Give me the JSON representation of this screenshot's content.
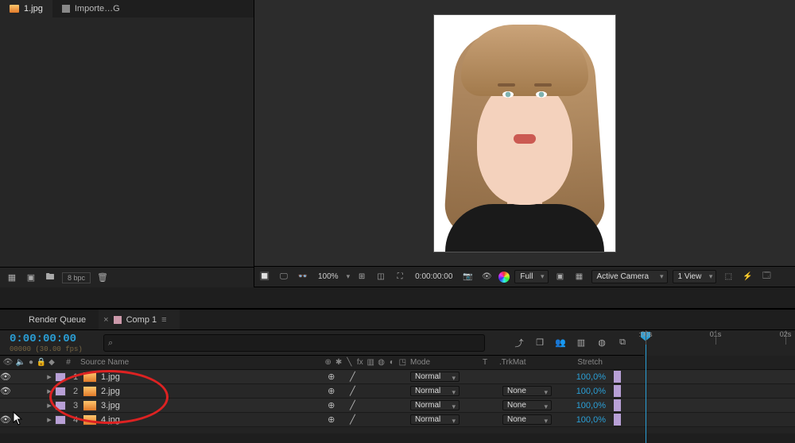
{
  "project": {
    "tabs": [
      {
        "label": "1.jpg",
        "kind": "image"
      },
      {
        "label": "Importe…G",
        "kind": "folder"
      }
    ],
    "bpc": "8 bpc"
  },
  "viewer": {
    "zoom": "100%",
    "time": "0:00:00:00",
    "resolution": "Full",
    "camera": "Active Camera",
    "views": "1 View"
  },
  "timeline": {
    "tabs": {
      "render_queue": "Render Queue",
      "comp": "Comp 1"
    },
    "timecode": "0:00:00:00",
    "frames_fps": "00000 (30.00 fps)",
    "search_placeholder": "",
    "ruler": {
      "marks": [
        ":00s",
        "01s",
        "02s"
      ]
    },
    "columns": {
      "idx": "#",
      "source": "Source Name",
      "mode": "Mode",
      "t": "T",
      "trkmat": ".TrkMat",
      "stretch": "Stretch"
    },
    "layers": [
      {
        "index": "1",
        "name": "1.jpg",
        "mode": "Normal",
        "trkmat": "",
        "stretch": "100,0%",
        "visible": true
      },
      {
        "index": "2",
        "name": "2.jpg",
        "mode": "Normal",
        "trkmat": "None",
        "stretch": "100,0%",
        "visible": true
      },
      {
        "index": "3",
        "name": "3.jpg",
        "mode": "Normal",
        "trkmat": "None",
        "stretch": "100,0%",
        "visible": false
      },
      {
        "index": "4",
        "name": "4.jpg",
        "mode": "Normal",
        "trkmat": "None",
        "stretch": "100,0%",
        "visible": true
      }
    ]
  }
}
